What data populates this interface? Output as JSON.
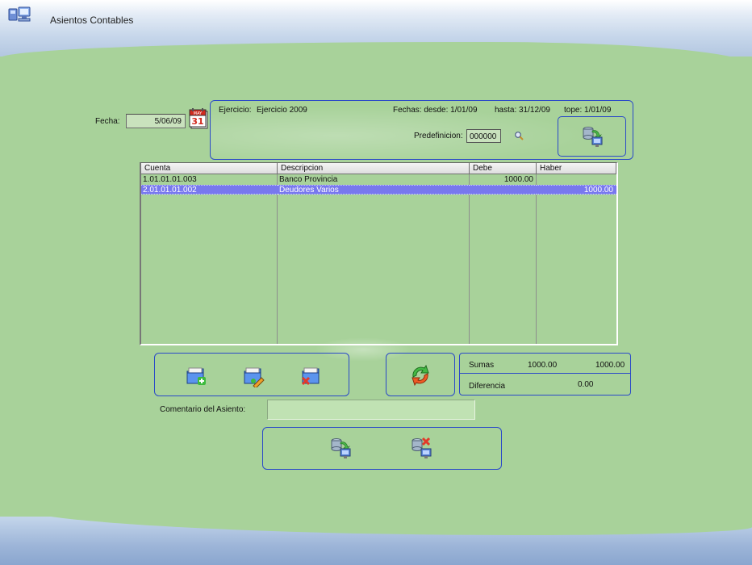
{
  "window": {
    "title": "Asientos Contables"
  },
  "fecha": {
    "label": "Fecha:",
    "value": "5/06/09"
  },
  "ejercicio": {
    "label": "Ejercicio:",
    "value": "Ejercicio 2009",
    "fechas": "Fechas: desde: 1/01/09",
    "hasta": "hasta: 31/12/09",
    "tope": "tope: 1/01/09",
    "predefinicion_label": "Predefinicion:",
    "predefinicion_value": "000000"
  },
  "grid": {
    "columns": [
      "Cuenta",
      "Descripcion",
      "Debe",
      "Haber"
    ],
    "rows": [
      {
        "cuenta": "1.01.01.01.003",
        "descripcion": "Banco Provincia",
        "debe": "1000.00",
        "haber": ""
      },
      {
        "cuenta": "2.01.01.01.002",
        "descripcion": "Deudores Varios",
        "debe": "",
        "haber": "1000.00",
        "selected": true
      }
    ]
  },
  "totals": {
    "sumas_label": "Sumas",
    "sumas_debe": "1000.00",
    "sumas_haber": "1000.00",
    "diferencia_label": "Diferencia",
    "diferencia_value": "0.00"
  },
  "comment": {
    "label": "Comentario del Asiento:",
    "value": ""
  },
  "icons": {
    "app": "computers-icon",
    "calendar": "calendar-icon",
    "search": "magnifier-icon",
    "transfer": "database-transfer-icon",
    "add": "folder-add-icon",
    "edit": "folder-edit-icon",
    "delete": "folder-delete-icon",
    "refresh": "refresh-arrows-icon",
    "confirm": "database-confirm-icon",
    "cancel": "database-cancel-icon"
  },
  "colors": {
    "background": "#a8d29a",
    "panel_border": "#2a49c8",
    "selected_row": "#7878ee"
  }
}
